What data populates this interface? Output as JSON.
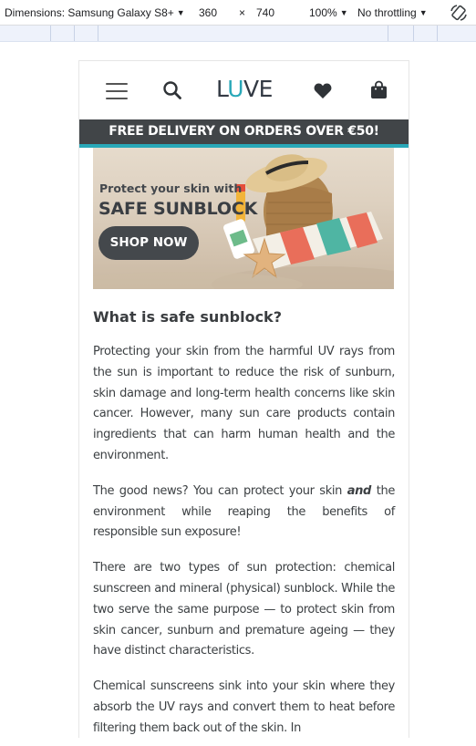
{
  "devtools": {
    "dimensions_label": "Dimensions: Samsung Galaxy S8+",
    "width": "360",
    "times": "×",
    "height": "740",
    "zoom": "100%",
    "throttling": "No throttling",
    "caret": "▼"
  },
  "site": {
    "logo": {
      "part1": "L",
      "part2": "U",
      "part3": "VE"
    },
    "delivery_banner": "FREE DELIVERY ON ORDERS OVER €50!",
    "accent_color": "#29a8b8"
  },
  "banner": {
    "line1": "Protect your skin with",
    "line2": "SAFE SUNBLOCK",
    "button": "SHOP NOW"
  },
  "article": {
    "heading": "What is safe sunblock?",
    "p1": "Protecting your skin from the harmful UV rays from the sun is important to reduce the risk of sunburn, skin damage and long-term health concerns like skin cancer. However, many sun care products contain ingredients that can harm human health and the environment.",
    "p2_before": "The good news? You can protect your skin ",
    "p2_em": "and",
    "p2_after": " the environment while reaping the benefits of responsible sun exposure!",
    "p3": "There are two types of sun protection: chemical sunscreen and mineral (physical) sunblock. While the two serve the same purpose — to protect skin from skin cancer, sunburn and premature ageing — they have distinct characteristics.",
    "p4": "Chemical sunscreens sink into your skin where they absorb the UV rays and convert them to heat before filtering them back out of the skin. In"
  }
}
